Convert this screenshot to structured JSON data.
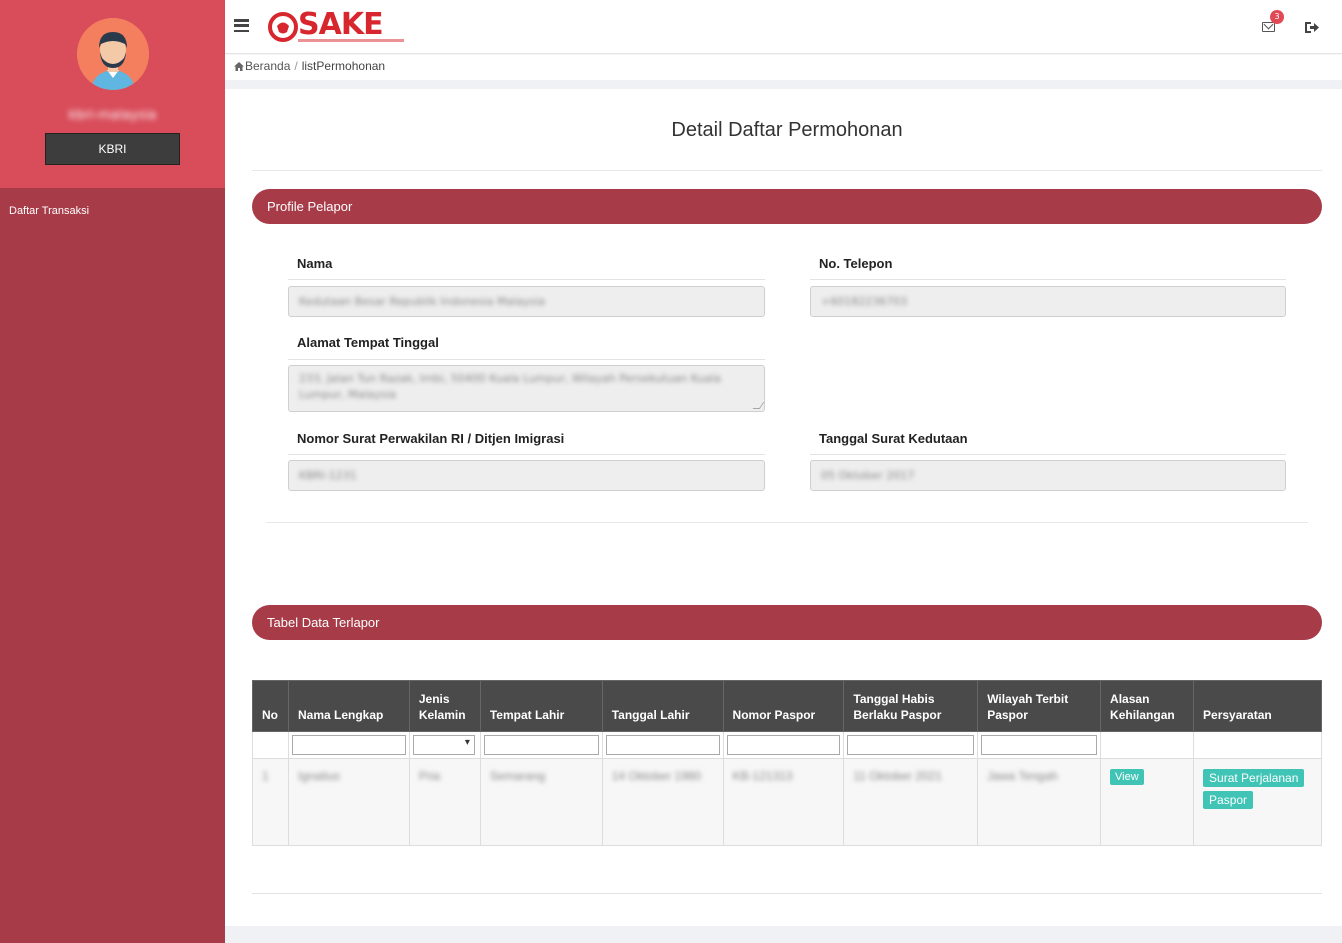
{
  "sidebar": {
    "username": "kbri-malaysia",
    "role_label": "KBRI",
    "nav_items": [
      {
        "label": "Daftar Transaksi"
      }
    ]
  },
  "topbar": {
    "logo_text": "SAKE",
    "mail_count": "3"
  },
  "breadcrumb": {
    "home": "Beranda",
    "sep": "/",
    "current": "listPermohonan"
  },
  "page": {
    "title": "Detail Daftar Permohonan"
  },
  "profile": {
    "section_title": "Profile Pelapor",
    "nama_label": "Nama",
    "nama_value": "Kedutaan Besar Republik Indonesia Malaysia",
    "telepon_label": "No. Telepon",
    "telepon_value": "+60182236703",
    "alamat_label": "Alamat Tempat Tinggal",
    "alamat_value": "233, Jalan Tun Razak, Imbi, 50400 Kuala Lumpur, Wilayah Persekutuan Kuala Lumpur, Malaysia",
    "nomor_surat_label": "Nomor Surat Perwakilan RI / Ditjen Imigrasi",
    "nomor_surat_value": "KBRI-1231",
    "tanggal_surat_label": "Tanggal Surat Kedutaan",
    "tanggal_surat_value": "05 Oktober 2017"
  },
  "table": {
    "section_title": "Tabel Data Terlapor",
    "headers": [
      "No",
      "Nama Lengkap",
      "Jenis Kelamin",
      "Tempat Lahir",
      "Tanggal Lahir",
      "Nomor Paspor",
      "Tanggal Habis Berlaku Paspor",
      "Wilayah Terbit Paspor",
      "Alasan Kehilangan",
      "Persyaratan"
    ],
    "rows": [
      {
        "no": "1",
        "nama": "Ignatius",
        "jenis_kelamin": "Pria",
        "tempat_lahir": "Semarang",
        "tanggal_lahir": "14 Oktober 1980",
        "nomor_paspor": "KB-121313",
        "tanggal_habis": "11 Oktober 2021",
        "wilayah": "Jawa Tengah",
        "alasan_button": "View",
        "persyaratan_buttons": [
          "Surat Perjalanan",
          "Paspor"
        ]
      }
    ]
  },
  "colors": {
    "sidebar_bg": "#a83b48",
    "sidebar_head_bg": "#d94c5a",
    "section_bar": "#a83b48",
    "table_header": "#4a4a4a",
    "teal_button": "#3fc4b6",
    "logo_red": "#d7262d"
  }
}
